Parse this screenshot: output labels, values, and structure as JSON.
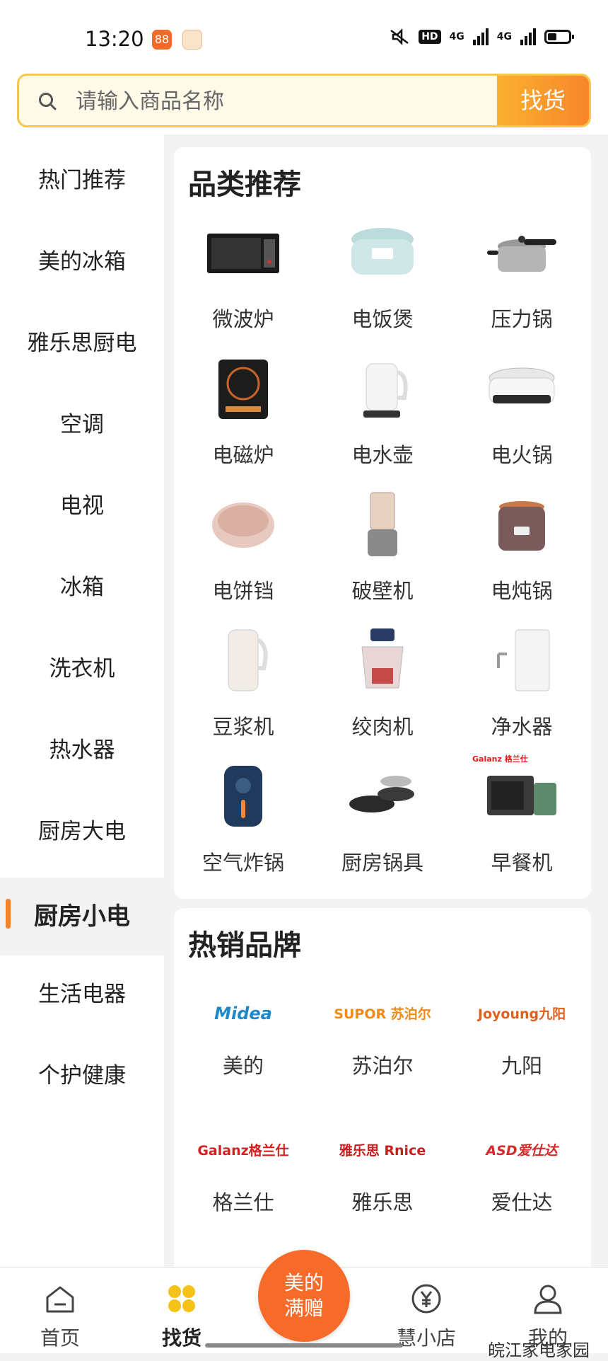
{
  "status_bar": {
    "time": "13:20",
    "hd_badge": "HD",
    "network_1": "4G",
    "network_2": "4G"
  },
  "search": {
    "placeholder": "请输入商品名称",
    "button": "找货"
  },
  "sidebar": {
    "items": [
      {
        "label": "热门推荐"
      },
      {
        "label": "美的冰箱"
      },
      {
        "label": "雅乐思厨电"
      },
      {
        "label": "空调"
      },
      {
        "label": "电视"
      },
      {
        "label": "冰箱"
      },
      {
        "label": "洗衣机"
      },
      {
        "label": "热水器"
      },
      {
        "label": "厨房大电"
      },
      {
        "label": "厨房小电",
        "active": true
      },
      {
        "label": "生活电器"
      },
      {
        "label": "个护健康"
      }
    ]
  },
  "categories": {
    "title": "品类推荐",
    "items": [
      {
        "label": "微波炉",
        "icon": "microwave-icon"
      },
      {
        "label": "电饭煲",
        "icon": "rice-cooker-icon"
      },
      {
        "label": "压力锅",
        "icon": "pressure-cooker-icon"
      },
      {
        "label": "电磁炉",
        "icon": "induction-cooker-icon"
      },
      {
        "label": "电水壶",
        "icon": "kettle-icon"
      },
      {
        "label": "电火锅",
        "icon": "hot-pot-icon"
      },
      {
        "label": "电饼铛",
        "icon": "pancake-maker-icon"
      },
      {
        "label": "破壁机",
        "icon": "blender-icon"
      },
      {
        "label": "电炖锅",
        "icon": "stew-pot-icon"
      },
      {
        "label": "豆浆机",
        "icon": "soymilk-maker-icon"
      },
      {
        "label": "绞肉机",
        "icon": "meat-grinder-icon"
      },
      {
        "label": "净水器",
        "icon": "water-purifier-icon"
      },
      {
        "label": "空气炸锅",
        "icon": "air-fryer-icon"
      },
      {
        "label": "厨房锅具",
        "icon": "cookware-icon"
      },
      {
        "label": "早餐机",
        "icon": "breakfast-machine-icon"
      }
    ]
  },
  "brands": {
    "title": "热销品牌",
    "items": [
      {
        "name": "美的",
        "logo_text": "Midea",
        "color": "#1e88c9"
      },
      {
        "name": "苏泊尔",
        "logo_text": "SUPOR 苏泊尔",
        "color": "#f08a18"
      },
      {
        "name": "九阳",
        "logo_text": "Joyoung九阳",
        "color": "#e0601e"
      },
      {
        "name": "格兰仕",
        "logo_text": "Galanz格兰仕",
        "color": "#d62020"
      },
      {
        "name": "雅乐思",
        "logo_text": "雅乐思 Rnice",
        "color": "#c81e1e"
      },
      {
        "name": "爱仕达",
        "logo_text": "ASD爱仕达",
        "color": "#d42a2a"
      }
    ]
  },
  "breakfast_brand_text": "Galanz 格兰仕",
  "tabbar": {
    "home": "首页",
    "find": "找货",
    "center_line1": "美的",
    "center_line2": "满赠",
    "shop": "慧小店",
    "mine": "我的"
  },
  "watermark_account": "皖江家电家园",
  "colors": {
    "accent": "#f6822b",
    "search_border": "#f5c84a"
  }
}
